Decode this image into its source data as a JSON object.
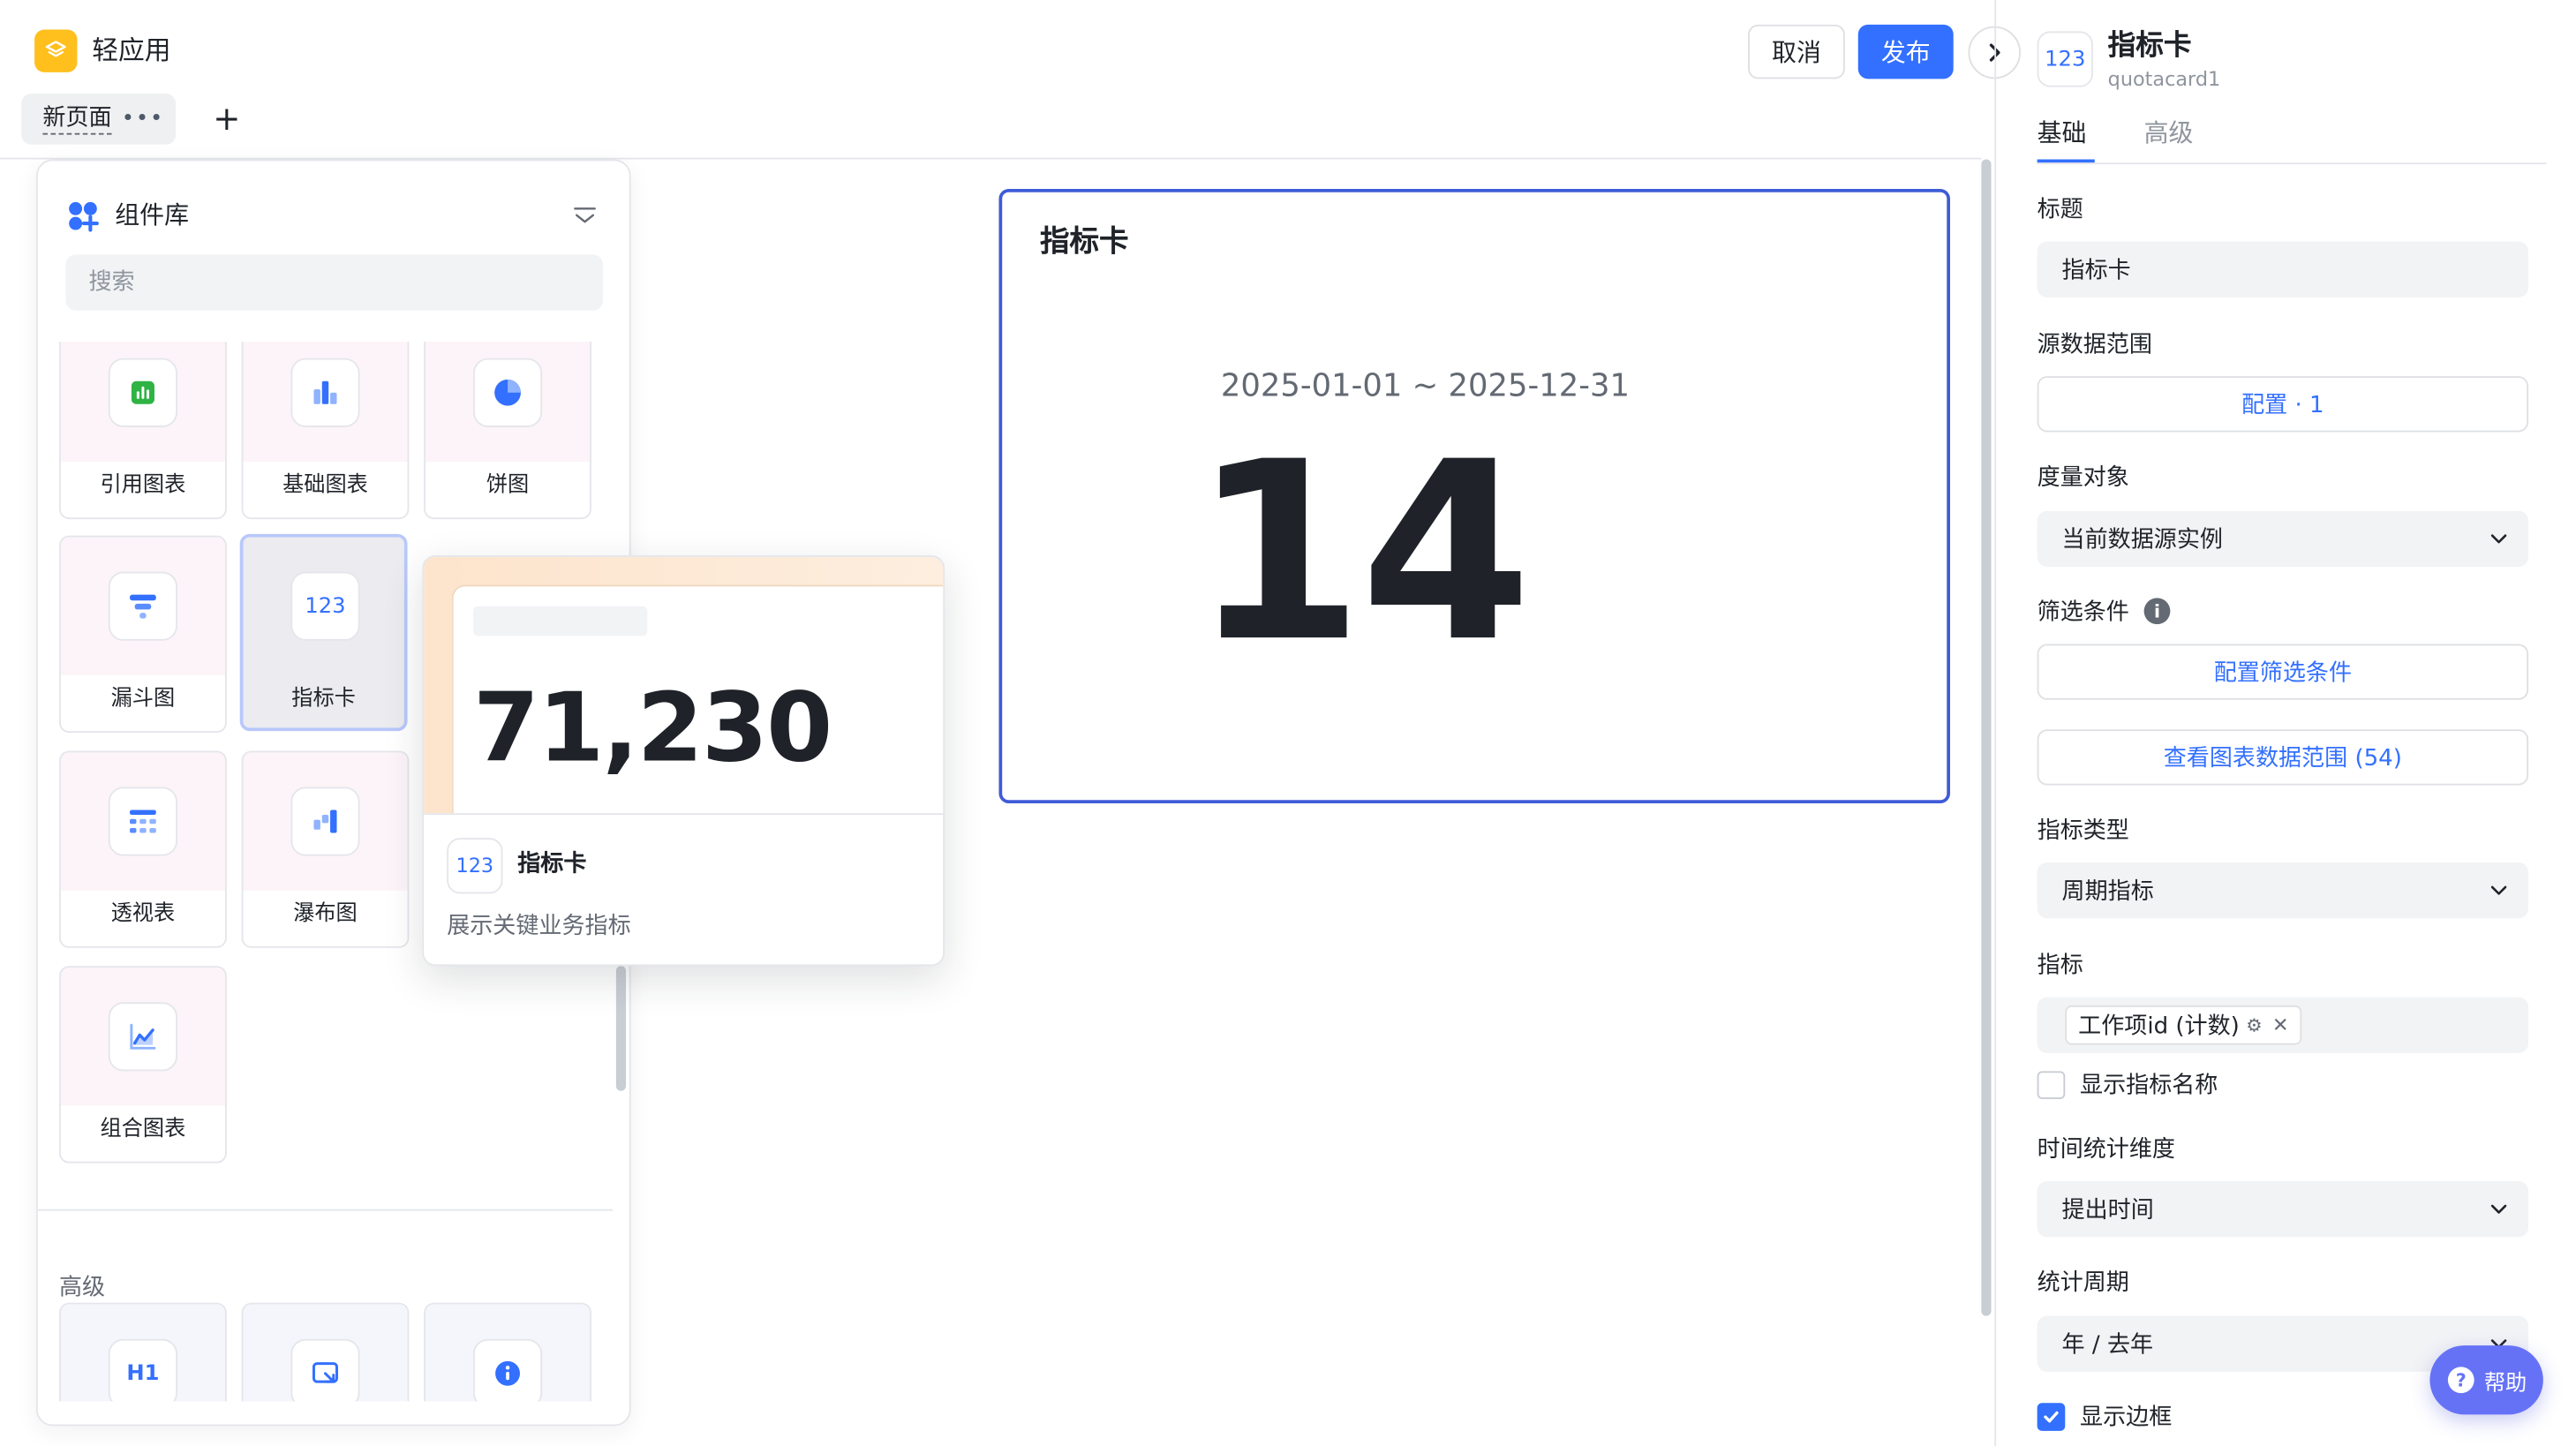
{
  "app": {
    "title": "轻应用"
  },
  "tabs": {
    "current": "新页面",
    "more": "•••",
    "add": "+"
  },
  "header": {
    "cancel_label": "取消",
    "publish_label": "发布"
  },
  "library": {
    "title": "组件库",
    "search_placeholder": "搜索",
    "items": [
      {
        "label": "引用图表",
        "icon": "reference-chart-icon"
      },
      {
        "label": "基础图表",
        "icon": "bar-chart-icon"
      },
      {
        "label": "饼图",
        "icon": "pie-chart-icon"
      },
      {
        "label": "漏斗图",
        "icon": "funnel-chart-icon"
      },
      {
        "label": "指标卡",
        "icon": "metric-card-icon",
        "icon_text": "123",
        "selected": true
      },
      {
        "label": "透视表",
        "icon": "pivot-table-icon"
      },
      {
        "label": "瀑布图",
        "icon": "waterfall-chart-icon"
      },
      {
        "label": "组合图表",
        "icon": "combo-chart-icon"
      }
    ],
    "advanced_title": "高级",
    "advanced_items": [
      {
        "icon": "heading-icon",
        "icon_text": "H1"
      },
      {
        "icon": "embed-icon"
      },
      {
        "icon": "info-icon"
      }
    ]
  },
  "preview": {
    "value": "71,230",
    "icon_text": "123",
    "title": "指标卡",
    "description": "展示关键业务指标"
  },
  "widget": {
    "title": "指标卡",
    "date_range": "2025-01-01 ~ 2025-12-31",
    "value": "14"
  },
  "props": {
    "icon_text": "123",
    "title": "指标卡",
    "id": "quotacard1",
    "tabs": [
      "基础",
      "高级"
    ],
    "active_tab": "基础",
    "title_label": "标题",
    "title_value": "指标卡",
    "source_label": "源数据范围",
    "source_button": "配置 · 1",
    "measure_label": "度量对象",
    "measure_value": "当前数据源实例",
    "filter_label": "筛选条件",
    "filter_button": "配置筛选条件",
    "view_range_button": "查看图表数据范围 (54)",
    "metric_type_label": "指标类型",
    "metric_type_value": "周期指标",
    "metric_label": "指标",
    "metric_tag": "工作项id (计数)",
    "show_metric_name_label": "显示指标名称",
    "show_metric_name_checked": false,
    "time_dim_label": "时间统计维度",
    "time_dim_value": "提出时间",
    "period_label": "统计周期",
    "period_value": "年 / 去年",
    "show_border_label": "显示边框",
    "show_border_checked": true
  },
  "help": {
    "label": "帮助"
  },
  "colors": {
    "accent": "#3370ff",
    "logo": "#ffc01e",
    "selection_border": "#3f5bd7",
    "help": "#6672f6"
  }
}
